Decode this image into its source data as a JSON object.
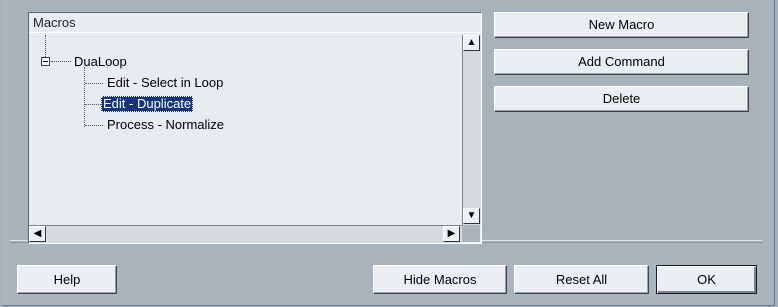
{
  "macros_panel": {
    "header": "Macros",
    "tree": {
      "root": {
        "label": "DuaLoop",
        "expanded": true,
        "expander_glyph": "−"
      },
      "children": [
        {
          "label": "Edit - Select in Loop",
          "selected": false
        },
        {
          "label": "Edit - Duplicate",
          "selected": true
        },
        {
          "label": "Process - Normalize",
          "selected": false
        }
      ]
    },
    "scrollbar": {
      "up": "▲",
      "down": "▼",
      "left": "◀",
      "right": "▶"
    }
  },
  "side_buttons": {
    "new_macro": "New Macro",
    "add_command": "Add Command",
    "delete": "Delete"
  },
  "bottom_buttons": {
    "help": "Help",
    "hide_macros": "Hide Macros",
    "reset_all": "Reset All",
    "ok": "OK"
  },
  "colors": {
    "dialog_bg": "#a9b4bd",
    "tree_bg": "#e9ecef",
    "selection_bg": "#14357a",
    "button_face": "#eceff1"
  }
}
